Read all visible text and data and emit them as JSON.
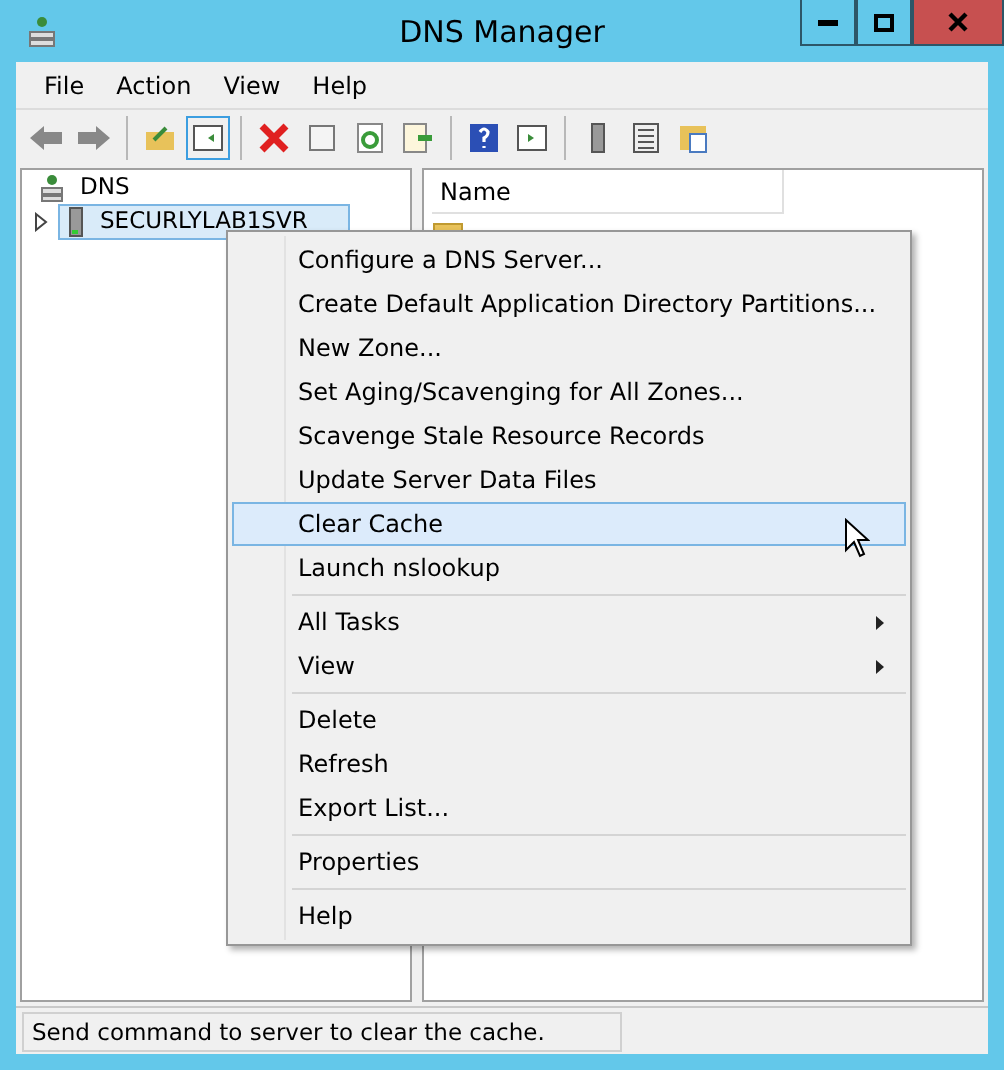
{
  "window": {
    "title": "DNS Manager"
  },
  "menu_bar": [
    "File",
    "Action",
    "View",
    "Help"
  ],
  "tree": [
    {
      "label": "DNS",
      "selected": false,
      "children": [
        {
          "label": "SECURLYLAB1SVR",
          "selected": true,
          "expanded": false
        }
      ]
    }
  ],
  "list": {
    "columns": [
      "Name"
    ],
    "rows": [
      {
        "kind": "folder"
      }
    ]
  },
  "context_menu": [
    {
      "label": "Configure a DNS Server...",
      "kind": "item",
      "selected": false
    },
    {
      "label": "Create Default Application Directory Partitions...",
      "kind": "item",
      "selected": false
    },
    {
      "label": "New Zone...",
      "kind": "item",
      "selected": false
    },
    {
      "label": "Set Aging/Scavenging for All Zones...",
      "kind": "item",
      "selected": false
    },
    {
      "label": "Scavenge Stale Resource Records",
      "kind": "item",
      "selected": false
    },
    {
      "label": "Update Server Data Files",
      "kind": "item",
      "selected": false
    },
    {
      "label": "Clear Cache",
      "kind": "item",
      "selected": true
    },
    {
      "label": "Launch nslookup",
      "kind": "item",
      "selected": false
    },
    {
      "kind": "separator"
    },
    {
      "label": "All Tasks",
      "kind": "submenu",
      "selected": false
    },
    {
      "label": "View",
      "kind": "submenu",
      "selected": false
    },
    {
      "kind": "separator"
    },
    {
      "label": "Delete",
      "kind": "item",
      "selected": false
    },
    {
      "label": "Refresh",
      "kind": "item",
      "selected": false
    },
    {
      "label": "Export List...",
      "kind": "item",
      "selected": false
    },
    {
      "kind": "separator"
    },
    {
      "label": "Properties",
      "kind": "item",
      "selected": false
    },
    {
      "kind": "separator"
    },
    {
      "label": "Help",
      "kind": "item",
      "selected": false
    }
  ],
  "status_bar": "Send command to server to clear the cache."
}
